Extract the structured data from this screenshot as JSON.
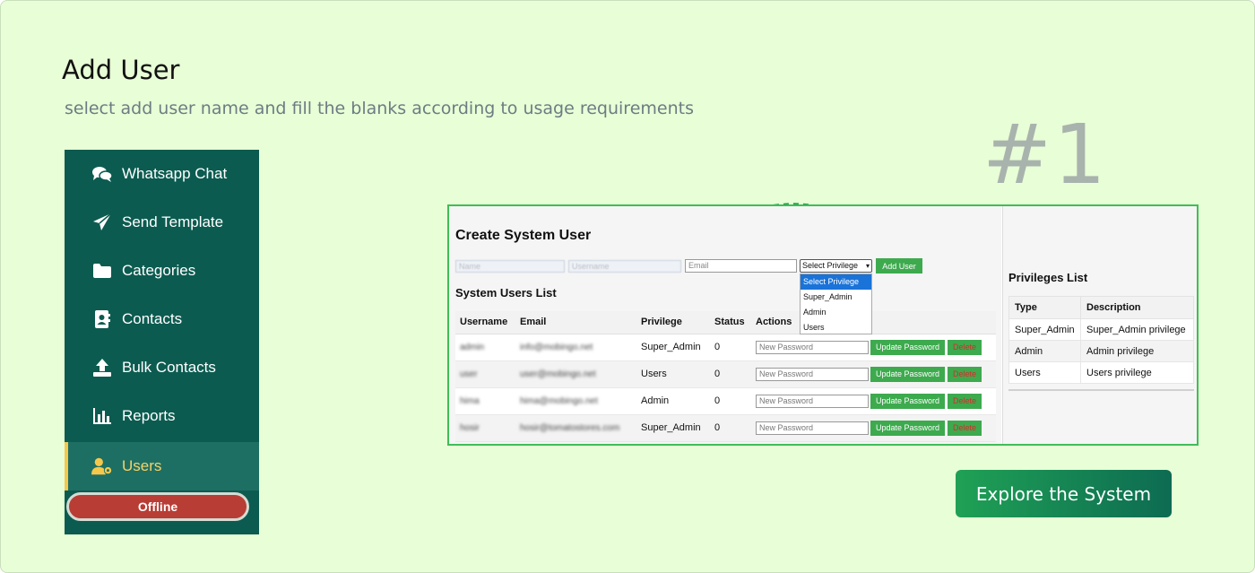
{
  "header": {
    "title": "Add User",
    "subtitle": "select add user name and fill the blanks according to usage requirements",
    "step_number": "#1"
  },
  "sidebar": {
    "items": [
      {
        "label": "Whatsapp Chat",
        "icon": "chat-icon"
      },
      {
        "label": "Send Template",
        "icon": "send-icon"
      },
      {
        "label": "Categories",
        "icon": "folder-icon"
      },
      {
        "label": "Contacts",
        "icon": "contact-icon"
      },
      {
        "label": "Bulk Contacts",
        "icon": "upload-icon"
      },
      {
        "label": "Reports",
        "icon": "chart-icon"
      },
      {
        "label": "Users",
        "icon": "users-gear-icon",
        "active": true
      }
    ],
    "status_label": "Offline"
  },
  "form": {
    "title": "Create System User",
    "name_placeholder": "Name",
    "username_placeholder": "Username",
    "email_placeholder": "Email",
    "privilege_selected": "Select Privilege",
    "privilege_options": [
      "Select Privilege",
      "Super_Admin",
      "Admin",
      "Users"
    ],
    "add_button": "Add User"
  },
  "users_list": {
    "title": "System Users List",
    "columns": [
      "Username",
      "Email",
      "Privilege",
      "Status",
      "Actions"
    ],
    "rows": [
      {
        "username": "admin",
        "email": "info@mobingo.net",
        "privilege": "Super_Admin",
        "status": "0"
      },
      {
        "username": "user",
        "email": "user@mobingo.net",
        "privilege": "Users",
        "status": "0"
      },
      {
        "username": "hima",
        "email": "hima@mobingo.net",
        "privilege": "Admin",
        "status": "0"
      },
      {
        "username": "hosir",
        "email": "hosir@tomatostores.com",
        "privilege": "Super_Admin",
        "status": "0"
      }
    ],
    "password_placeholder": "New Password",
    "update_button": "Update Password",
    "delete_button": "Delete"
  },
  "privileges_list": {
    "title": "Privileges List",
    "columns": [
      "Type",
      "Description"
    ],
    "rows": [
      {
        "type": "Super_Admin",
        "description": "Super_Admin privilege"
      },
      {
        "type": "Admin",
        "description": "Admin privilege"
      },
      {
        "type": "Users",
        "description": "Users privilege"
      }
    ]
  },
  "cta": {
    "label": "Explore the System"
  },
  "colors": {
    "background": "#e8fed6",
    "sidebar": "#0c5b50",
    "accent_green": "#3daa4e",
    "offline_red": "#b83d35",
    "active_text": "#f5d36a"
  }
}
